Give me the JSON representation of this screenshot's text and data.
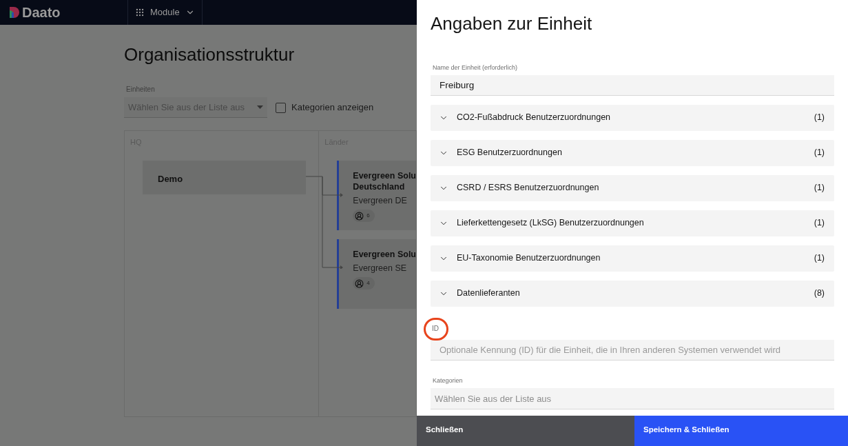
{
  "header": {
    "logo": "Daato",
    "menu": "Module"
  },
  "page": {
    "title": "Organisationsstruktur",
    "units_label": "Einheiten",
    "units_placeholder": "Wählen Sie aus der Liste aus",
    "show_categories": {
      "label": "Kategorien anzeigen",
      "checked": false
    }
  },
  "board": {
    "columns": [
      {
        "title": "HQ",
        "units": [
          {
            "name": "Demo"
          }
        ]
      },
      {
        "title": "Länder",
        "units": [
          {
            "name": "Evergreen Solu\nDeutschland",
            "short": "Evergreen DE",
            "users": "6"
          },
          {
            "name": "Evergreen Solu",
            "short": "Evergreen SE",
            "users": "4"
          }
        ]
      }
    ]
  },
  "panel": {
    "title": "Angaben zur Einheit",
    "name_label": "Name der Einheit (erforderlich)",
    "name_value": "Freiburg",
    "sections": [
      {
        "label": "CO2-Fußabdruck Benutzerzuordnungen",
        "count": "(1)",
        "expanded": false
      },
      {
        "label": "ESG Benutzerzuordnungen",
        "count": "(1)",
        "expanded": false
      },
      {
        "label": "CSRD / ESRS Benutzerzuordnungen",
        "count": "(1)",
        "expanded": false
      },
      {
        "label": "Lieferkettengesetz (LkSG) Benutzerzuordnungen",
        "count": "(1)",
        "expanded": false
      },
      {
        "label": "EU-Taxonomie Benutzerzuordnungen",
        "count": "(1)",
        "expanded": false
      },
      {
        "label": "Datenlieferanten",
        "count": "(8)",
        "expanded": false
      }
    ],
    "id_label": "ID",
    "id_placeholder": "Optionale Kennung (ID) für die Einheit, die in Ihren anderen Systemen verwendet wird",
    "categories_label": "Kategorien",
    "categories_placeholder": "Wählen Sie aus der Liste aus",
    "buttons": [
      {
        "label": "Schließen",
        "kind": "secondary"
      },
      {
        "label": "Speichern & Schließen",
        "kind": "primary"
      }
    ]
  }
}
